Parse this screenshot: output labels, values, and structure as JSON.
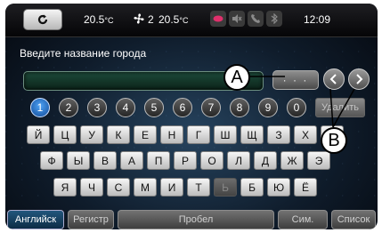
{
  "status": {
    "temp_left": "20.5",
    "temp_left_unit": "°C",
    "fan_level": "2",
    "temp_right": "20.5",
    "temp_right_unit": "°C",
    "time": "12:09"
  },
  "prompt": "Введите название города",
  "input_value": "",
  "more_label": "· · ·",
  "numbers": [
    "1",
    "2",
    "3",
    "4",
    "5",
    "6",
    "7",
    "8",
    "9",
    "0"
  ],
  "delete_label": "Удалить",
  "row1": [
    "Й",
    "Ц",
    "У",
    "К",
    "Е",
    "Н",
    "Г",
    "Ш",
    "Щ",
    "З",
    "Х",
    "Ъ"
  ],
  "row2": [
    "Ф",
    "Ы",
    "В",
    "А",
    "П",
    "Р",
    "О",
    "Л",
    "Д",
    "Ж",
    "Э"
  ],
  "row3": [
    "Я",
    "Ч",
    "С",
    "М",
    "И",
    "Т",
    "Ь",
    "Б",
    "Ю",
    "Ё"
  ],
  "bottom": {
    "english": "Английск",
    "shift": "Регистр",
    "space": "Пробел",
    "symbols": "Сим.",
    "list": "Список"
  },
  "callouts": {
    "a": "A",
    "b": "B"
  },
  "colors": {
    "selected_number": "#2f7fd6",
    "active_key": "#1c4f78"
  }
}
